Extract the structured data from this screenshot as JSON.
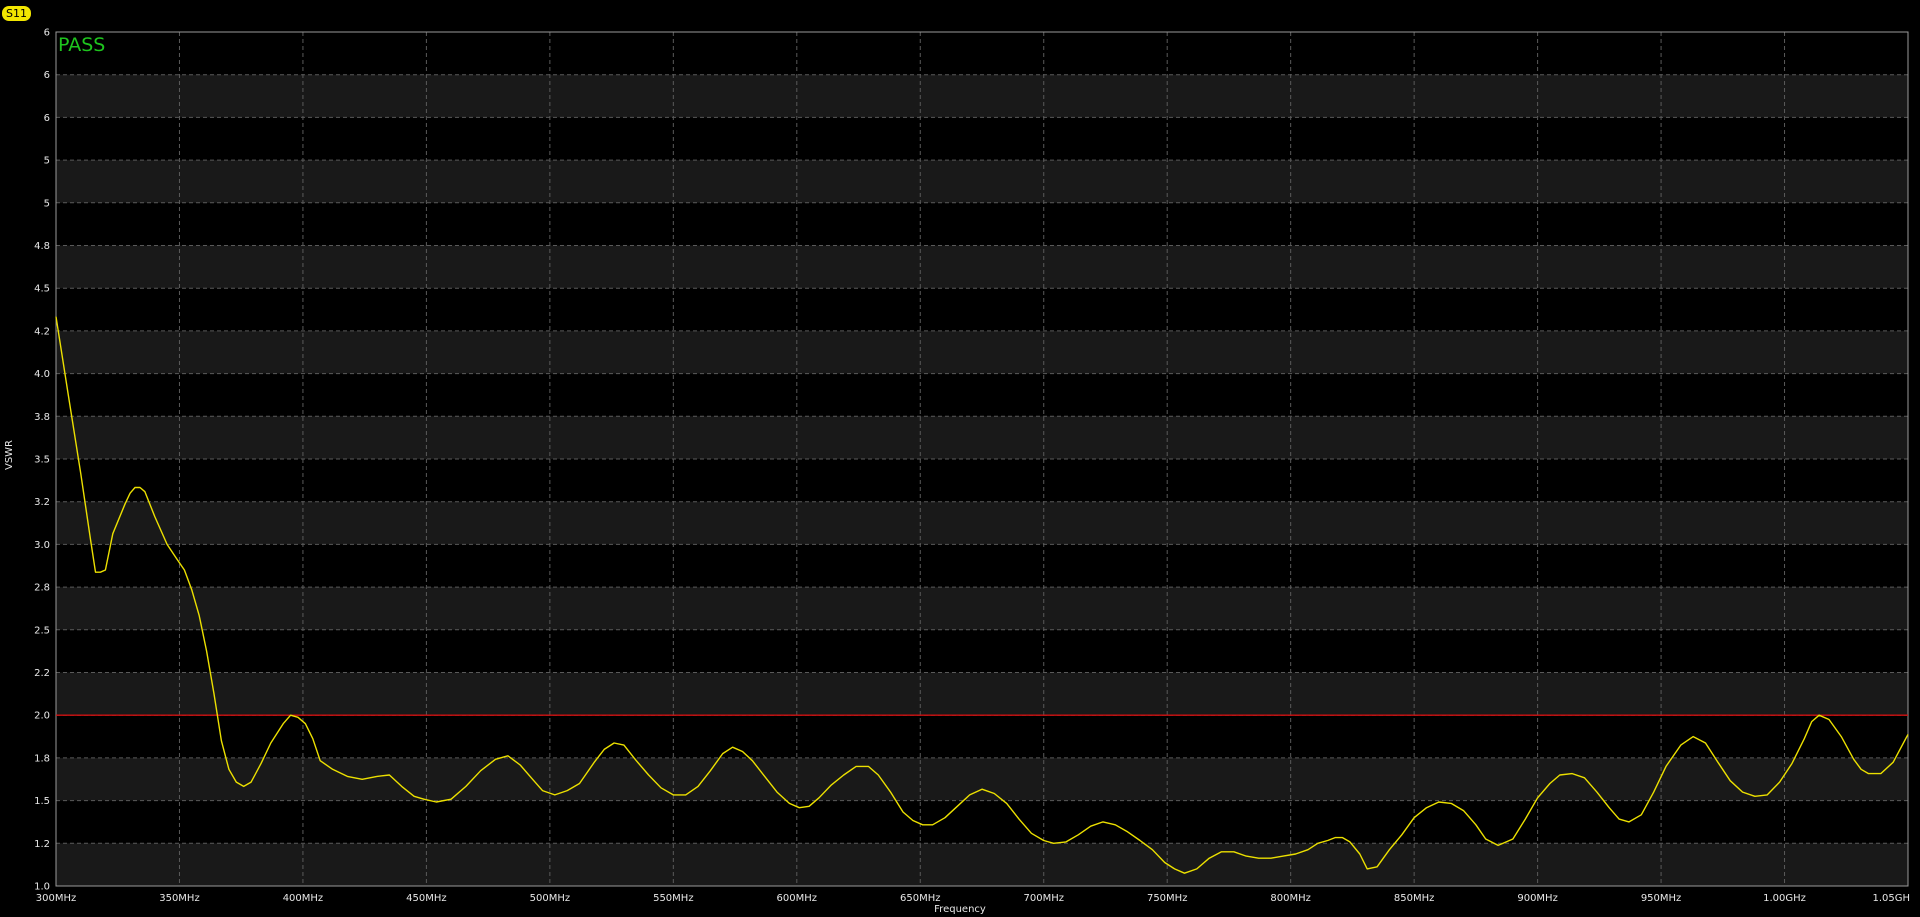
{
  "trace_badge": "S11",
  "status_text": "PASS",
  "colors": {
    "background": "#000000",
    "band": "#191919",
    "grid": "#5a5a5a",
    "trace": "#ece000",
    "limit": "#d01010",
    "status": "#1ec51e",
    "badge": "#f2e600"
  },
  "chart_data": {
    "type": "line",
    "xlabel": "Frequency",
    "ylabel": "VSWR",
    "xlim": [
      300,
      1050
    ],
    "x_tick_labels": [
      "300MHz",
      "350MHz",
      "400MHz",
      "450MHz",
      "500MHz",
      "550MHz",
      "600MHz",
      "650MHz",
      "700MHz",
      "750MHz",
      "800MHz",
      "850MHz",
      "900MHz",
      "950MHz",
      "1.00GHz",
      "1.05GH"
    ],
    "y_tick_labels": [
      "6",
      "6",
      "6",
      "5",
      "5",
      "4.8",
      "4.5",
      "4.2",
      "4.0",
      "3.8",
      "3.5",
      "3.2",
      "3.0",
      "2.8",
      "2.5",
      "2.2",
      "2.0",
      "1.8",
      "1.5",
      "1.2",
      "1.0"
    ],
    "grid": true,
    "limit_line": {
      "value": 2.0,
      "tick_index": 16
    },
    "series": [
      {
        "x": [
          300,
          305,
          310,
          314,
          316,
          318,
          320,
          323,
          328,
          330,
          332,
          334,
          336,
          340,
          345,
          349,
          352,
          355,
          358,
          361,
          364,
          367,
          370,
          373,
          376,
          379,
          383,
          387,
          392,
          395,
          398,
          401,
          404,
          407,
          412,
          418,
          424,
          430,
          435,
          440,
          445,
          449,
          454,
          460,
          466,
          472,
          478,
          483,
          488,
          493,
          497,
          502,
          507,
          512,
          518,
          522,
          526,
          530,
          535,
          540,
          545,
          550,
          555,
          560,
          565,
          570,
          574,
          578,
          582,
          587,
          592,
          597,
          601,
          605,
          609,
          614,
          619,
          624,
          629,
          633,
          638,
          643,
          647,
          651,
          655,
          660,
          665,
          670,
          675,
          680,
          685,
          690,
          695,
          700,
          704,
          709,
          714,
          719,
          724,
          729,
          734,
          739,
          744,
          749,
          753,
          757,
          762,
          767,
          772,
          777,
          782,
          787,
          792,
          797,
          802,
          807,
          811,
          815,
          818,
          821,
          824,
          828,
          831,
          835,
          840,
          845,
          850,
          855,
          860,
          865,
          870,
          875,
          879,
          884,
          890,
          895,
          900,
          905,
          909,
          914,
          919,
          924,
          929,
          933,
          937,
          942,
          947,
          952,
          958,
          963,
          968,
          973,
          978,
          983,
          988,
          993,
          998,
          1003,
          1008,
          1011,
          1014,
          1018,
          1023,
          1028,
          1031,
          1034,
          1039,
          1044,
          1050
        ],
        "y": [
          4.3,
          3.9,
          3.4,
          3.02,
          2.87,
          2.87,
          2.88,
          3.05,
          3.19,
          3.26,
          3.3,
          3.3,
          3.27,
          3.13,
          3.0,
          2.93,
          2.88,
          2.78,
          2.6,
          2.35,
          2.1,
          1.88,
          1.72,
          1.63,
          1.6,
          1.63,
          1.76,
          1.87,
          1.96,
          2.0,
          1.99,
          1.96,
          1.89,
          1.78,
          1.72,
          1.67,
          1.65,
          1.67,
          1.68,
          1.6,
          1.53,
          1.51,
          1.49,
          1.51,
          1.6,
          1.71,
          1.79,
          1.81,
          1.75,
          1.65,
          1.57,
          1.54,
          1.57,
          1.62,
          1.77,
          1.84,
          1.87,
          1.86,
          1.78,
          1.68,
          1.59,
          1.54,
          1.54,
          1.6,
          1.71,
          1.82,
          1.85,
          1.83,
          1.78,
          1.67,
          1.56,
          1.48,
          1.45,
          1.46,
          1.52,
          1.61,
          1.68,
          1.74,
          1.74,
          1.68,
          1.56,
          1.42,
          1.36,
          1.33,
          1.33,
          1.38,
          1.46,
          1.54,
          1.58,
          1.55,
          1.48,
          1.37,
          1.27,
          1.22,
          1.2,
          1.21,
          1.26,
          1.32,
          1.35,
          1.33,
          1.28,
          1.22,
          1.17,
          1.11,
          1.08,
          1.06,
          1.08,
          1.13,
          1.16,
          1.16,
          1.14,
          1.13,
          1.13,
          1.14,
          1.15,
          1.17,
          1.2,
          1.22,
          1.24,
          1.24,
          1.21,
          1.15,
          1.08,
          1.09,
          1.17,
          1.26,
          1.38,
          1.45,
          1.49,
          1.48,
          1.43,
          1.33,
          1.23,
          1.19,
          1.23,
          1.37,
          1.52,
          1.62,
          1.68,
          1.69,
          1.66,
          1.56,
          1.45,
          1.37,
          1.35,
          1.4,
          1.56,
          1.74,
          1.86,
          1.9,
          1.87,
          1.77,
          1.64,
          1.56,
          1.53,
          1.54,
          1.63,
          1.76,
          1.89,
          1.97,
          2.0,
          1.98,
          1.9,
          1.79,
          1.72,
          1.69,
          1.69,
          1.77,
          1.91
        ]
      }
    ]
  }
}
